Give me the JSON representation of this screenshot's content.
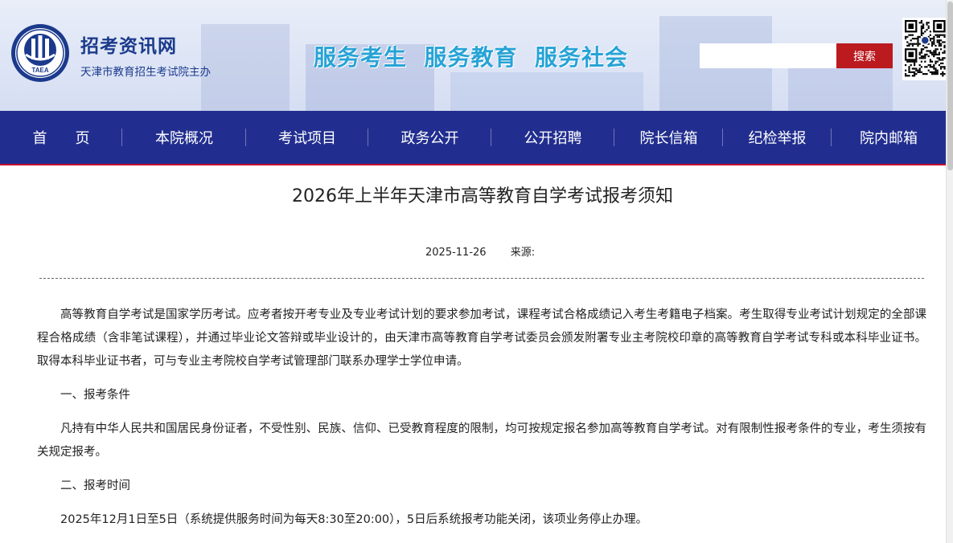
{
  "header": {
    "site_name": "招考资讯网",
    "site_sub": "天津市教育招生考试院主办",
    "logo_text": "TAEA",
    "slogan": "服务考生  服务教育  服务社会",
    "search": {
      "placeholder": "",
      "button_label": "搜索"
    },
    "qr_icon": "qr-code-icon"
  },
  "nav": {
    "items": [
      {
        "label": "首页"
      },
      {
        "label": "本院概况"
      },
      {
        "label": "考试项目"
      },
      {
        "label": "政务公开"
      },
      {
        "label": "公开招聘"
      },
      {
        "label": "院长信箱"
      },
      {
        "label": "纪检举报"
      },
      {
        "label": "院内邮箱"
      }
    ]
  },
  "article": {
    "title": "2026年上半年天津市高等教育自学考试报考须知",
    "date": "2025-11-26",
    "source_label": "来源:",
    "paragraphs": [
      "高等教育自学考试是国家学历考试。应考者按开考专业及专业考试计划的要求参加考试，课程考试合格成绩记入考生考籍电子档案。考生取得专业考试计划规定的全部课程合格成绩（含非笔试课程），并通过毕业论文答辩或毕业设计的，由天津市高等教育自学考试委员会颁发附署专业主考院校印章的高等教育自学考试专科或本科毕业证书。取得本科毕业证书者，可与专业主考院校自学考试管理部门联系办理学士学位申请。",
      "一、报考条件",
      "凡持有中华人民共和国居民身份证者，不受性别、民族、信仰、已受教育程度的限制，均可按规定报名参加高等教育自学考试。对有限制性报考条件的专业，考生须按有关规定报考。",
      "二、报考时间",
      "2025年12月1日至5日（系统提供服务时间为每天8:30至20:00），5日后系统报考功能关闭，该项业务停止办理。"
    ]
  },
  "colors": {
    "nav_bg": "#222e8f",
    "accent_red": "#bb1a1f",
    "slogan": "#27a3d6",
    "brand_blue": "#1b3a8c"
  }
}
